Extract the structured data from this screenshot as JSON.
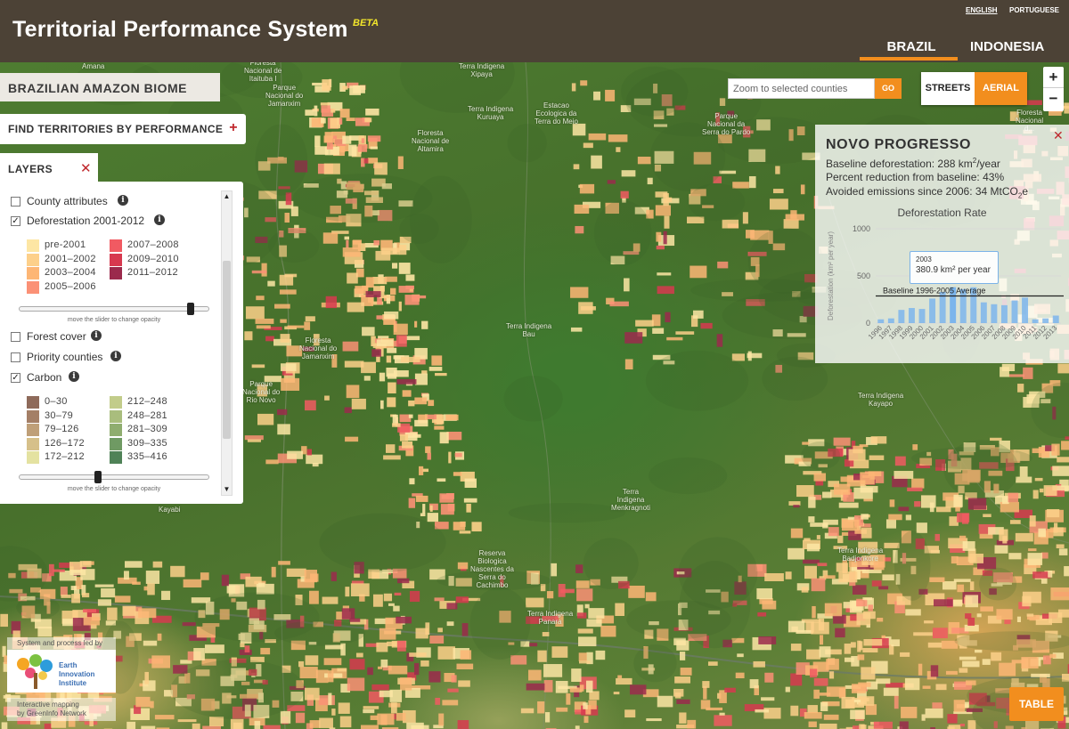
{
  "header": {
    "title": "Territorial Performance System",
    "beta": "BETA",
    "languages": [
      "ENGLISH",
      "PORTUGUESE"
    ],
    "tabs": [
      "BRAZIL",
      "INDONESIA"
    ],
    "active_tab": "BRAZIL"
  },
  "biome_label": "BRAZILIAN AMAZON BIOME",
  "find_button": {
    "label": "FIND TERRITORIES BY PERFORMANCE",
    "icon": "+"
  },
  "layers": {
    "title": "LAYERS",
    "close": "✕",
    "items": [
      {
        "label": "County attributes",
        "checked": false
      },
      {
        "label": "Deforestation 2001-2012",
        "checked": true
      },
      {
        "label": "Forest cover",
        "checked": false
      },
      {
        "label": "Priority counties",
        "checked": false
      },
      {
        "label": "Carbon",
        "checked": true
      }
    ],
    "deforestation_legend": [
      {
        "label": "pre-2001",
        "color": "#fde6a4"
      },
      {
        "label": "2001–2002",
        "color": "#fdd08a"
      },
      {
        "label": "2003–2004",
        "color": "#fdb675"
      },
      {
        "label": "2005–2006",
        "color": "#fb9176"
      },
      {
        "label": "2007–2008",
        "color": "#f15a62"
      },
      {
        "label": "2009–2010",
        "color": "#d7394f"
      },
      {
        "label": "2011–2012",
        "color": "#9b2a4c"
      }
    ],
    "carbon_legend": [
      {
        "label": "0–30",
        "color": "#8e6a5a"
      },
      {
        "label": "30–79",
        "color": "#a47f66"
      },
      {
        "label": "79–126",
        "color": "#bf9f78"
      },
      {
        "label": "126–172",
        "color": "#d6c08a"
      },
      {
        "label": "172–212",
        "color": "#e4e2a1"
      },
      {
        "label": "212–248",
        "color": "#c2cc8a"
      },
      {
        "label": "248–281",
        "color": "#a9bd7d"
      },
      {
        "label": "281–309",
        "color": "#8fad6f"
      },
      {
        "label": "309–335",
        "color": "#6f9a63"
      },
      {
        "label": "335–416",
        "color": "#4f8257"
      }
    ],
    "slider_caption": "move the slider to change opacity",
    "deforestation_opacity": 0.92,
    "carbon_opacity": 0.41
  },
  "search": {
    "placeholder": "Zoom to selected counties",
    "go_label": "GO"
  },
  "basemap": {
    "streets": "STREETS",
    "aerial": "AERIAL",
    "active": "AERIAL"
  },
  "zoom": {
    "in": "+",
    "out": "−"
  },
  "info_panel": {
    "close": "✕",
    "title": "NOVO PROGRESSO",
    "baseline_prefix": "Baseline deforestation: 288 km",
    "baseline_sup": "2",
    "baseline_suffix": "/year",
    "reduction": "Percent reduction from baseline: 43%",
    "emissions_prefix": "Avoided emissions since 2006: 34 MtCO",
    "emissions_sub": "2",
    "emissions_suffix": "e",
    "tooltip": {
      "year": "2003",
      "value": "380.9 km² per year"
    }
  },
  "chart_data": {
    "type": "bar",
    "title": "Deforestation Rate",
    "ylabel": "Deforestation (km² per year)",
    "categories": [
      "1996",
      "1997",
      "1998",
      "1999",
      "2000",
      "2001",
      "2002",
      "2003",
      "2004",
      "2005",
      "2006",
      "2007",
      "2008",
      "2009",
      "2010",
      "2011",
      "2012",
      "2013"
    ],
    "values": [
      40,
      50,
      140,
      160,
      150,
      260,
      330,
      380.9,
      360,
      380,
      220,
      200,
      190,
      240,
      270,
      40,
      50,
      80
    ],
    "ylim": [
      0,
      1000
    ],
    "yticks": [
      0,
      500,
      1000
    ],
    "reference_line": {
      "label": "Baseline 1996-2005 Average",
      "value": 288
    },
    "highlight": "2003",
    "bar_color": "#7cb5ec"
  },
  "map_labels": {
    "l1": "Terra Indigena\nXipaya",
    "l2": "Terra Indigena\nKuruaya",
    "l3": "Estacao\nEcologica da\nTerra do Meio",
    "l4": "Parque\nNacional do\nJamanxim",
    "l5": "Floresta\nNacional de\nAltamira",
    "l6": "Parque\nNacional da\nSerra do Pardo",
    "l7": "Floresta\nNacional do\nJamanxim",
    "l8": "Parque\nNacional do\nRio Novo",
    "l9": "Terra Indigena\nBau",
    "l10": "Terra Indigena\nKayapo",
    "l11": "Terra\nIndigena\nMenkragnoti",
    "l12": "Reserva\nBiologica\nNascentes da\nSerra do\nCachimbo",
    "l13": "Terra Indigena\nPanara",
    "l14": "Terra Indigena\nBadjonkore",
    "l15": "Kayabi",
    "l16": "Floresta\nNacional de\nItaituba I",
    "l17": "Amana",
    "l18": "Floresta\nNacional\nd..."
  },
  "credits": {
    "led_by": "System and process led by",
    "logo_text": "Earth\nInnovation\nInstitute",
    "mapping": "Interactive mapping\nby GreenInfo Network"
  },
  "table_button": "TABLE"
}
